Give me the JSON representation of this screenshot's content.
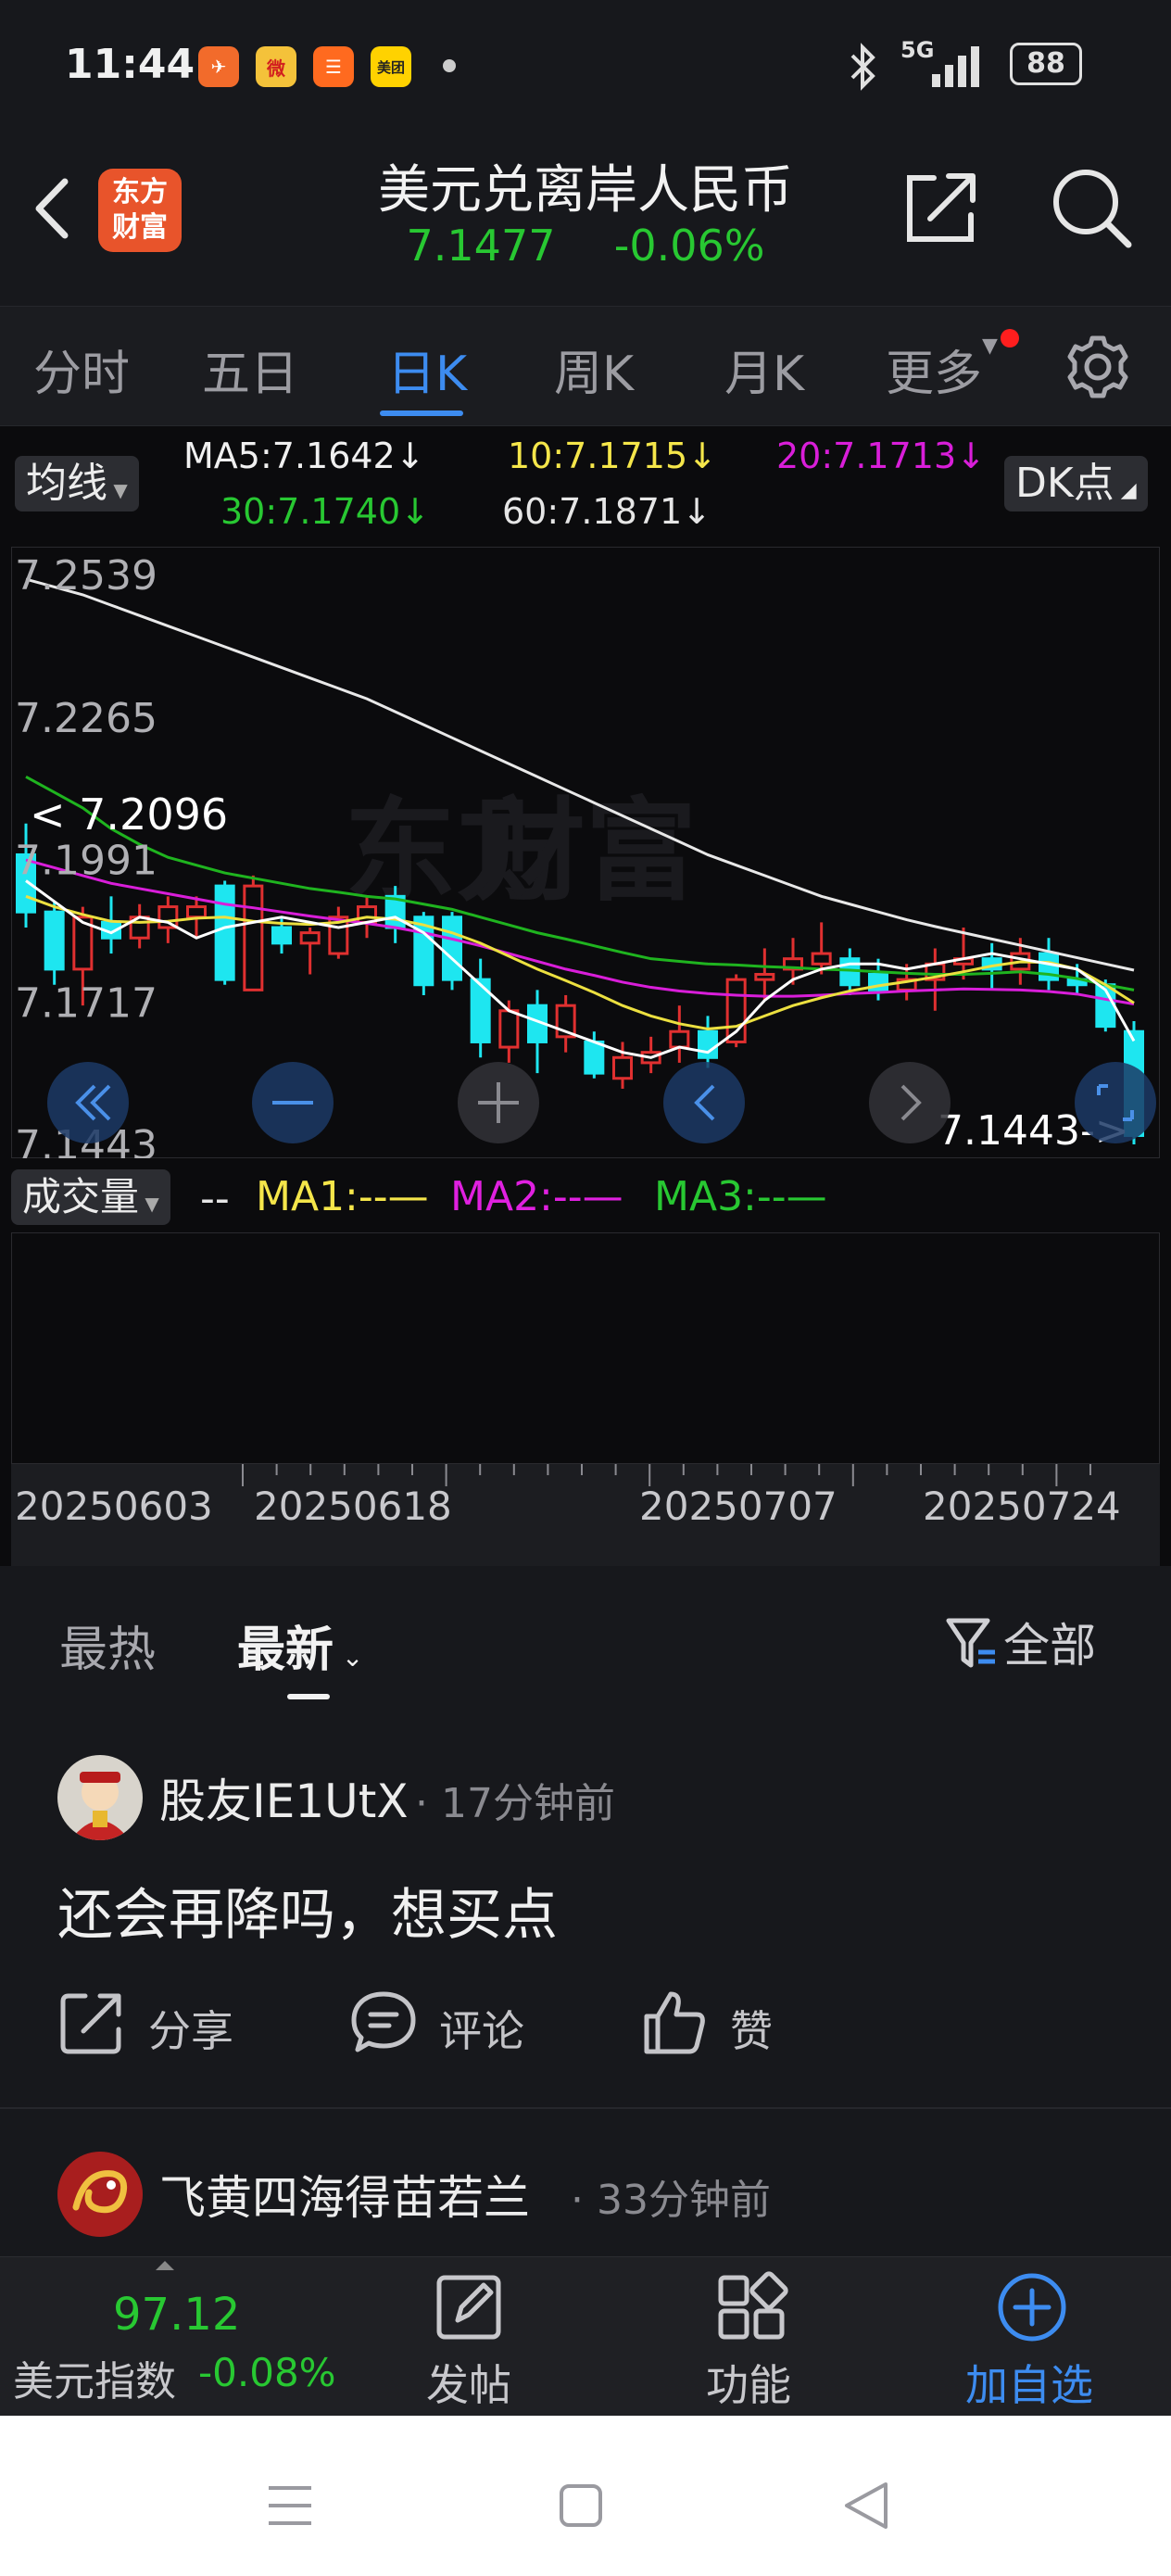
{
  "status_bar": {
    "time": "11:44",
    "apps": [
      "✈",
      "微",
      "☰",
      "美团"
    ],
    "network": "5G",
    "battery": "88"
  },
  "header": {
    "logo_text_1": "东方",
    "logo_text_2": "财富",
    "title": "美元兑离岸人民币",
    "price": "7.1477",
    "change": "-0.06%"
  },
  "tabs": [
    {
      "label": "分时"
    },
    {
      "label": "五日"
    },
    {
      "label": "日K"
    },
    {
      "label": "周K"
    },
    {
      "label": "月K"
    },
    {
      "label": "更多"
    }
  ],
  "chart_header": {
    "ma_select": "均线",
    "ma5": "MA5:7.1642↓",
    "ma10": "10:7.1715↓",
    "ma20": "20:7.1713↓",
    "ma30": "30:7.1740↓",
    "ma60": "60:7.1871↓",
    "dk_button": "DK点"
  },
  "chart_data": {
    "type": "candlestick",
    "y_ticks": [
      "7.2539",
      "7.2265",
      "7.1991",
      "7.1717",
      "7.1443"
    ],
    "ylim": [
      7.1443,
      7.2539
    ],
    "high_marker": "< 7.2096",
    "low_marker": "7.1443->",
    "x_labels": [
      "20250603",
      "20250618",
      "20250707",
      "20250724"
    ],
    "candles": [
      [
        7.2,
        7.189,
        7.206,
        7.186
      ],
      [
        7.189,
        7.178,
        7.191,
        7.175
      ],
      [
        7.178,
        7.188,
        7.19,
        7.171
      ],
      [
        7.187,
        7.184,
        7.192,
        7.181
      ],
      [
        7.184,
        7.188,
        7.1905,
        7.182
      ],
      [
        7.186,
        7.19,
        7.192,
        7.183
      ],
      [
        7.188,
        7.19,
        7.192,
        7.184
      ],
      [
        7.194,
        7.176,
        7.195,
        7.175
      ],
      [
        7.174,
        7.194,
        7.196,
        7.174
      ],
      [
        7.186,
        7.183,
        7.188,
        7.181
      ],
      [
        7.183,
        7.185,
        7.186,
        7.177
      ],
      [
        7.181,
        7.188,
        7.19,
        7.18
      ],
      [
        7.187,
        7.19,
        7.192,
        7.184
      ],
      [
        7.192,
        7.186,
        7.194,
        7.183
      ],
      [
        7.188,
        7.175,
        7.189,
        7.173
      ],
      [
        7.188,
        7.176,
        7.189,
        7.174
      ],
      [
        7.176,
        7.164,
        7.18,
        7.161
      ],
      [
        7.163,
        7.17,
        7.172,
        7.16
      ],
      [
        7.171,
        7.164,
        7.174,
        7.158
      ],
      [
        7.165,
        7.171,
        7.173,
        7.162
      ],
      [
        7.164,
        7.158,
        7.166,
        7.157
      ],
      [
        7.157,
        7.161,
        7.164,
        7.155
      ],
      [
        7.16,
        7.162,
        7.165,
        7.158
      ],
      [
        7.163,
        7.166,
        7.171,
        7.16
      ],
      [
        7.166,
        7.161,
        7.169,
        7.159
      ],
      [
        7.164,
        7.176,
        7.177,
        7.163
      ],
      [
        7.176,
        7.177,
        7.182,
        7.172
      ],
      [
        7.178,
        7.18,
        7.184,
        7.175
      ],
      [
        7.179,
        7.181,
        7.187,
        7.177
      ],
      [
        7.18,
        7.175,
        7.182,
        7.173
      ],
      [
        7.177,
        7.174,
        7.18,
        7.172
      ],
      [
        7.174,
        7.176,
        7.179,
        7.172
      ],
      [
        7.176,
        7.179,
        7.182,
        7.17
      ],
      [
        7.179,
        7.18,
        7.186,
        7.176
      ],
      [
        7.18,
        7.178,
        7.183,
        7.174
      ],
      [
        7.178,
        7.181,
        7.184,
        7.175
      ],
      [
        7.181,
        7.176,
        7.184,
        7.174
      ],
      [
        7.176,
        7.175,
        7.179,
        7.173
      ],
      [
        7.175,
        7.167,
        7.176,
        7.166
      ],
      [
        7.166,
        7.146,
        7.168,
        7.1443
      ]
    ],
    "series": [
      {
        "name": "MA60",
        "color": "#e8e8e8",
        "values": [
          7.253,
          7.2515,
          7.25,
          7.248,
          7.246,
          7.244,
          7.242,
          7.24,
          7.238,
          7.236,
          7.234,
          7.232,
          7.23,
          7.2275,
          7.225,
          7.2225,
          7.22,
          7.2175,
          7.215,
          7.2125,
          7.21,
          7.2075,
          7.205,
          7.2025,
          7.2,
          7.198,
          7.196,
          7.194,
          7.192,
          7.1905,
          7.189,
          7.1875,
          7.1862,
          7.185,
          7.1838,
          7.1826,
          7.1814,
          7.1802,
          7.179,
          7.1778
        ]
      },
      {
        "name": "MA30",
        "color": "#1fb41f",
        "values": [
          7.215,
          7.212,
          7.209,
          7.205,
          7.202,
          7.1995,
          7.198,
          7.1965,
          7.1955,
          7.1945,
          7.1935,
          7.1928,
          7.192,
          7.1915,
          7.1905,
          7.1895,
          7.188,
          7.1865,
          7.185,
          7.1838,
          7.1825,
          7.1812,
          7.18,
          7.1795,
          7.179,
          7.1788,
          7.1785,
          7.1783,
          7.178,
          7.1778,
          7.1775,
          7.1772,
          7.177,
          7.177,
          7.1772,
          7.1775,
          7.177,
          7.1762,
          7.175,
          7.174
        ]
      },
      {
        "name": "MA20",
        "color": "#d91ed9",
        "values": [
          7.199,
          7.1975,
          7.196,
          7.1945,
          7.1935,
          7.1925,
          7.1915,
          7.1905,
          7.1898,
          7.189,
          7.1882,
          7.1875,
          7.1868,
          7.186,
          7.185,
          7.1838,
          7.1825,
          7.181,
          7.1795,
          7.178,
          7.1768,
          7.1755,
          7.1745,
          7.1738,
          7.1733,
          7.173,
          7.1728,
          7.1728,
          7.173,
          7.1733,
          7.1735,
          7.1738,
          7.174,
          7.1742,
          7.1741,
          7.174,
          7.1737,
          7.1732,
          7.1722,
          7.1713
        ]
      },
      {
        "name": "MA10",
        "color": "#ece040",
        "values": [
          7.192,
          7.19,
          7.1885,
          7.1872,
          7.187,
          7.1872,
          7.1878,
          7.188,
          7.1872,
          7.1868,
          7.1866,
          7.187,
          7.188,
          7.1876,
          7.1865,
          7.185,
          7.183,
          7.1805,
          7.178,
          7.1758,
          7.1735,
          7.171,
          7.169,
          7.1675,
          7.1665,
          7.167,
          7.169,
          7.171,
          7.1725,
          7.1738,
          7.1748,
          7.1756,
          7.1765,
          7.1775,
          7.1786,
          7.1794,
          7.1793,
          7.178,
          7.175,
          7.1715
        ]
      },
      {
        "name": "MA5",
        "color": "#ffffff",
        "values": [
          7.195,
          7.191,
          7.187,
          7.185,
          7.188,
          7.187,
          7.184,
          7.186,
          7.187,
          7.188,
          7.187,
          7.186,
          7.187,
          7.188,
          7.185,
          7.18,
          7.175,
          7.17,
          7.168,
          7.166,
          7.164,
          7.162,
          7.161,
          7.163,
          7.162,
          7.166,
          7.172,
          7.176,
          7.178,
          7.179,
          7.179,
          7.178,
          7.179,
          7.18,
          7.181,
          7.18,
          7.179,
          7.178,
          7.174,
          7.1642
        ]
      }
    ]
  },
  "volume_header": {
    "select": "成交量",
    "dash": "--",
    "ma1": "MA1:--",
    "ma2": "MA2:--",
    "ma3": "MA3:--"
  },
  "comments": {
    "tab_hot": "最热",
    "tab_new": "最新",
    "filter": "全部",
    "posts": [
      {
        "user": "股友IE1UtX",
        "time": "· 17分钟前",
        "text": "还会再降吗，想买点",
        "share": "分享",
        "comment": "评论",
        "like": "赞"
      },
      {
        "user": "飞黄四海得苗若兰",
        "time": "· 33分钟前"
      }
    ]
  },
  "bottom_bar": {
    "index_value": "97.12",
    "index_name": "美元指数",
    "index_change": "-0.08%",
    "post": "发帖",
    "functions": "功能",
    "add_watch": "加自选"
  }
}
